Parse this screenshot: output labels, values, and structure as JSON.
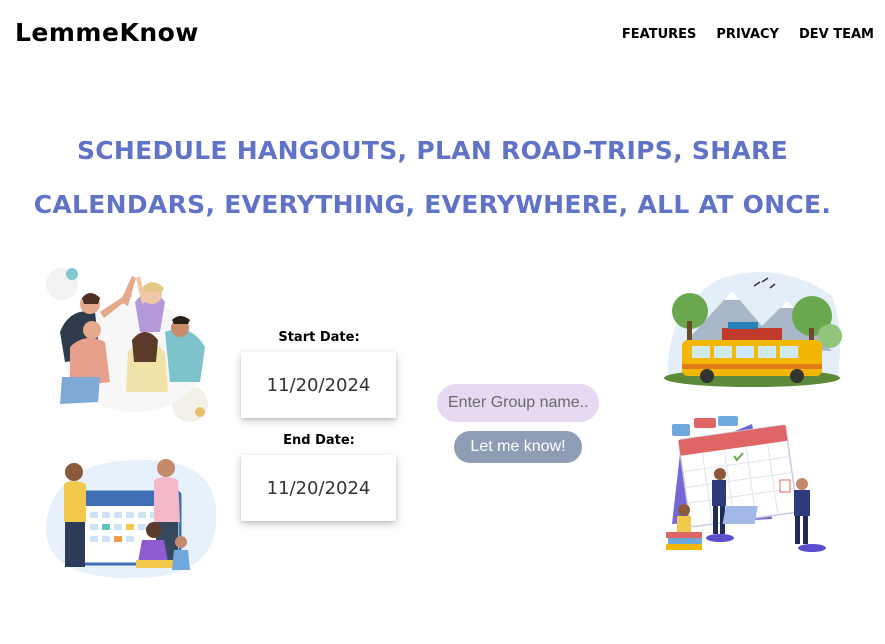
{
  "brand": {
    "name": "LemmeKnow"
  },
  "nav": {
    "items": [
      "FEATURES",
      "PRIVACY",
      "DEV TEAM"
    ]
  },
  "hero": {
    "line1": "SCHEDULE HANGOUTS, PLAN ROAD-TRIPS, SHARE",
    "line2": "CALENDARS, EVERYTHING, EVERYWHERE, ALL AT ONCE."
  },
  "form": {
    "start_label": "Start Date:",
    "start_value": "11/20/2024",
    "end_label": "End Date:",
    "end_value": "11/20/2024",
    "group_placeholder": "Enter Group name..",
    "submit_label": "Let me know!"
  },
  "colors": {
    "headline": "#6073c6",
    "input_bg": "#e6d9f1",
    "button_bg": "#8f9db4"
  }
}
